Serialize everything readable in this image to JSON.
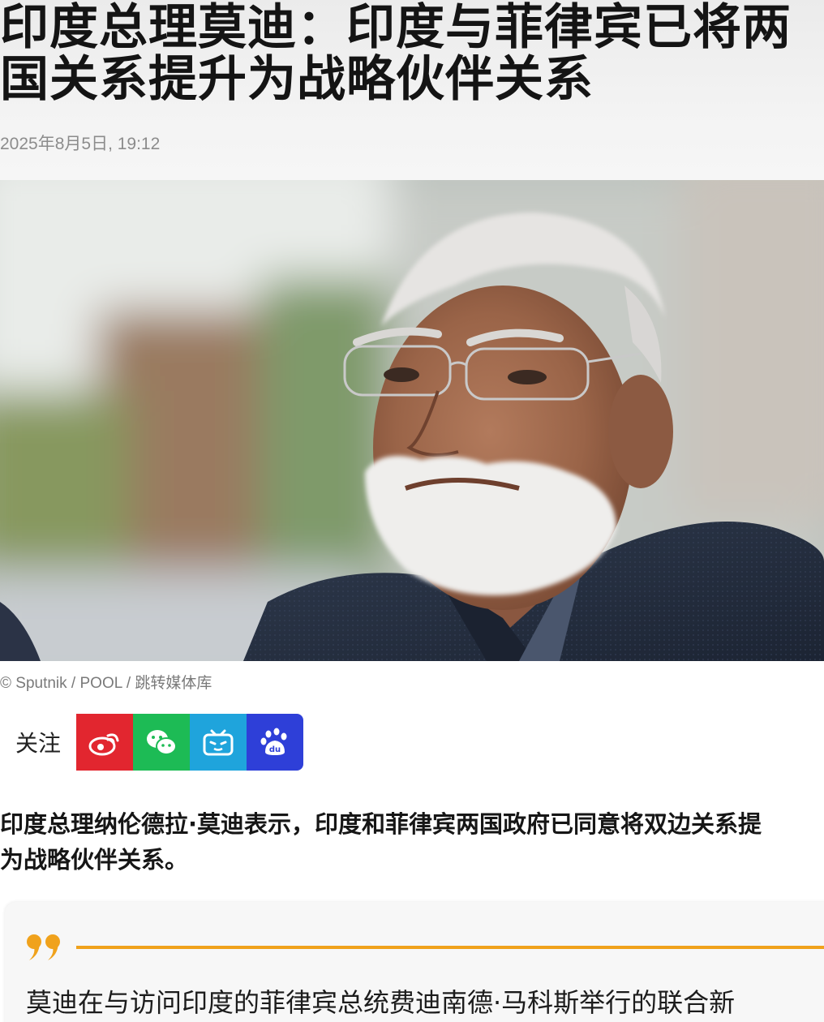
{
  "article": {
    "headline_line1": "印度总理莫迪：印度与菲律宾已将两",
    "headline_line2": "国关系提升为战略伙伴关系",
    "date": "2025年8月5日, 19:12"
  },
  "photo": {
    "credit": "© Sputnik / POOL / 跳转媒体库"
  },
  "follow": {
    "label": "关注",
    "channels": [
      {
        "name": "weibo",
        "icon": "weibo-icon",
        "color": "#e2262f"
      },
      {
        "name": "wechat",
        "icon": "wechat-icon",
        "color": "#1dbb55"
      },
      {
        "name": "bilibili",
        "icon": "bilibili-icon",
        "color": "#1fa4dc"
      },
      {
        "name": "baidu",
        "icon": "baidu-paw-icon",
        "color": "#2e3fd8"
      }
    ]
  },
  "lead": {
    "line1": "印度总理纳伦德拉·莫迪表示，印度和菲律宾两国政府已同意将双边关系提",
    "line2": "为战略伙伴关系。"
  },
  "quote": {
    "mark": "99",
    "accent_color": "#f0a21c",
    "text": "莫迪在与访问印度的菲律宾总统费迪南德·马科斯举行的联合新"
  }
}
